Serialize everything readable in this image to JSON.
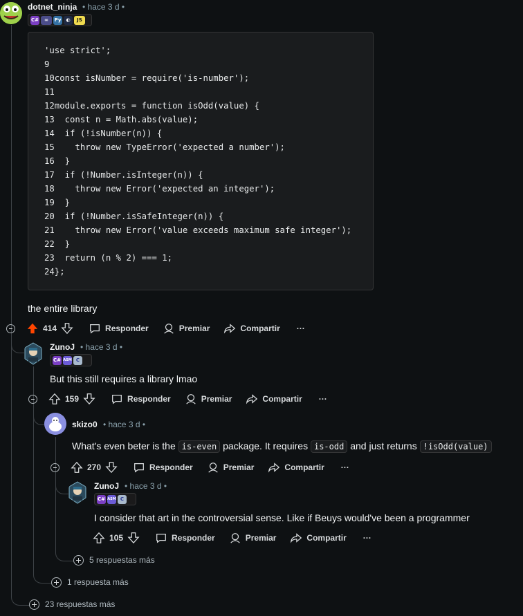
{
  "root": {
    "username": "dotnet_ninja",
    "time": "• hace 3 d •",
    "flair": [
      "C#",
      "∞",
      "Py",
      "◐",
      "JS"
    ],
    "code_lines": [
      "'use strict';",
      "9",
      "10const isNumber = require('is-number');",
      "11",
      "12module.exports = function isOdd(value) {",
      "13  const n = Math.abs(value);",
      "14  if (!isNumber(n)) {",
      "15    throw new TypeError('expected a number');",
      "16  }",
      "17  if (!Number.isInteger(n)) {",
      "18    throw new Error('expected an integer');",
      "19  }",
      "20  if (!Number.isSafeInteger(n)) {",
      "21    throw new Error('value exceeds maximum safe integer');",
      "22  }",
      "23  return (n % 2) === 1;",
      "24};"
    ],
    "text": "the entire library",
    "votes": "414",
    "reply": "Responder",
    "award": "Premiar",
    "share": "Compartir",
    "more": "···",
    "upvote_color": "#ff4500"
  },
  "c1": {
    "username": "ZunoJ",
    "time": "• hace 3 d •",
    "flair": [
      "C#",
      "ASM",
      "C"
    ],
    "text": "But this still requires a library lmao",
    "votes": "159",
    "reply": "Responder",
    "award": "Premiar",
    "share": "Compartir",
    "more": "···"
  },
  "c2": {
    "username": "skizo0",
    "time": "• hace 3 d •",
    "text_a": "What's even beter is the",
    "code_a": "is-even",
    "text_b": "package. It requires",
    "code_b": "is-odd",
    "text_c": "and just returns",
    "code_c": "!isOdd(value)",
    "votes": "270",
    "reply": "Responder",
    "award": "Premiar",
    "share": "Compartir",
    "more": "···"
  },
  "c3": {
    "username": "ZunoJ",
    "time": "• hace 3 d •",
    "flair": [
      "C#",
      "ASM",
      "C"
    ],
    "text": "I consider that art in the controversial sense. Like if Beuys would've been a programmer",
    "votes": "105",
    "reply": "Responder",
    "award": "Premiar",
    "share": "Compartir",
    "more": "···"
  },
  "more_replies": {
    "five": "5 respuestas más",
    "one": "1 respuesta más",
    "twentythree": "23 respuestas más"
  }
}
